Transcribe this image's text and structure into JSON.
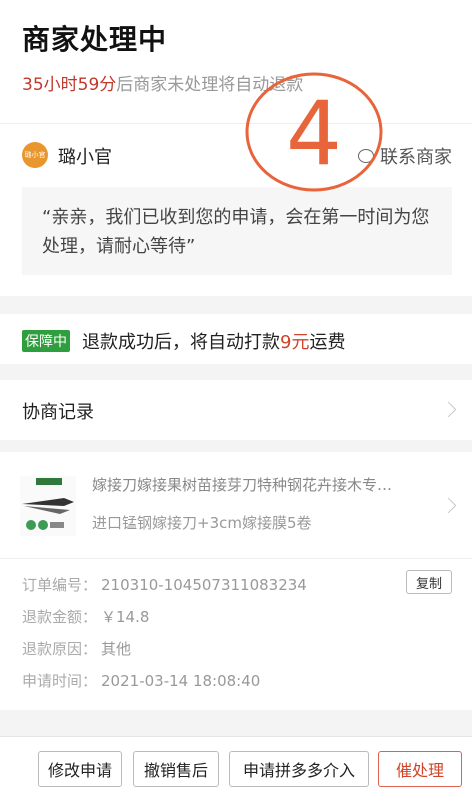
{
  "header": {
    "title": "商家处理中",
    "countdown_time": "35小时59分",
    "countdown_text": "后商家未处理将自动退款"
  },
  "merchant": {
    "avatar_text": "璐小官",
    "name": "璐小官",
    "contact_label": "联系商家"
  },
  "message": {
    "text": "“亲亲，我们已收到您的申请，会在第一时间为您处理，请耐心等待”"
  },
  "annotation": {
    "mark": "4",
    "color": "#e8643a"
  },
  "guarantee": {
    "badge": "保障中",
    "text_before": "退款成功后，将自动打款",
    "amount": "9元",
    "text_after": "运费"
  },
  "negotiation": {
    "label": "协商记录"
  },
  "product": {
    "title": "嫁接刀嫁接果树苗接芽刀特种钢花卉接木专…",
    "spec": "进口锰钢嫁接刀+3cm嫁接膜5卷"
  },
  "order": {
    "number_label": "订单编号：",
    "number": "210310-104507311083234",
    "copy_label": "复制",
    "amount_label": "退款金额：",
    "amount": "￥14.8",
    "reason_label": "退款原因：",
    "reason": "其他",
    "time_label": "申请时间：",
    "time": "2021-03-14 18:08:40"
  },
  "actions": {
    "modify": "修改申请",
    "cancel": "撤销售后",
    "intervene": "申请拼多多介入",
    "urge": "催处理"
  },
  "colors": {
    "accent": "#d0442a",
    "badge": "#2e9e3e"
  }
}
